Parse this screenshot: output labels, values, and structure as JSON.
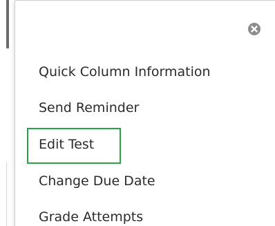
{
  "menu": {
    "close_icon": "close-circle-x",
    "items": [
      {
        "label": "Quick Column Information"
      },
      {
        "label": "Send Reminder"
      },
      {
        "label": "Edit Test",
        "highlighted": true
      },
      {
        "label": "Change Due Date"
      },
      {
        "label": "Grade Attempts"
      }
    ]
  },
  "colors": {
    "highlight": "#2aa146",
    "text": "#2b2b2b",
    "close_icon_bg": "#8c8c8c"
  }
}
